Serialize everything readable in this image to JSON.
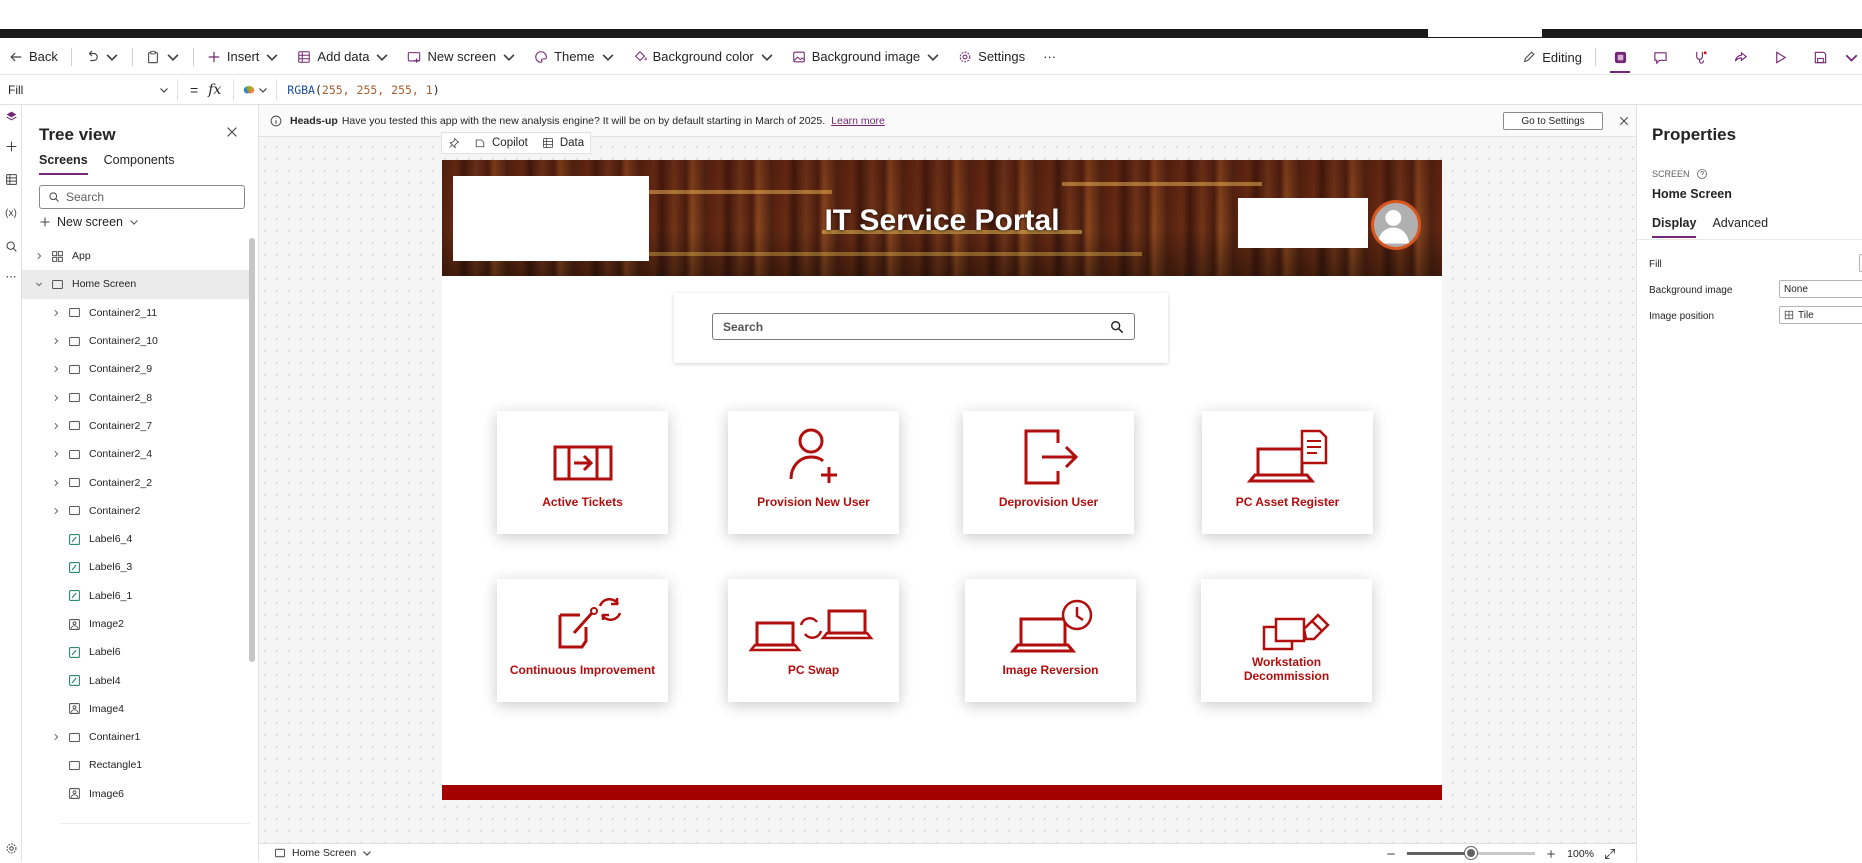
{
  "commandbar": {
    "back_label": "Back",
    "insert_label": "Insert",
    "add_data_label": "Add data",
    "new_screen_label": "New screen",
    "theme_label": "Theme",
    "bg_color_label": "Background color",
    "bg_image_label": "Background image",
    "settings_label": "Settings",
    "more_label": "···",
    "editing_label": "Editing"
  },
  "formulabar": {
    "property": "Fill",
    "fx": "fx",
    "equals": "=",
    "formula_fn": "RGBA",
    "formula_open": "(",
    "formula_args": "255, 255, 255, 1",
    "formula_close": ")"
  },
  "treeview": {
    "title": "Tree view",
    "tabs": [
      "Screens",
      "Components"
    ],
    "search_placeholder": "Search",
    "new_screen_label": "New screen",
    "nodes": [
      {
        "label": "App",
        "type": "app",
        "expandable": true,
        "indent": 0
      },
      {
        "label": "Home Screen",
        "type": "screen",
        "expandable": true,
        "expanded": true,
        "indent": 0,
        "selected": true
      },
      {
        "label": "Container2_11",
        "type": "container",
        "expandable": true,
        "indent": 1
      },
      {
        "label": "Container2_10",
        "type": "container",
        "expandable": true,
        "indent": 1
      },
      {
        "label": "Container2_9",
        "type": "container",
        "expandable": true,
        "indent": 1
      },
      {
        "label": "Container2_8",
        "type": "container",
        "expandable": true,
        "indent": 1
      },
      {
        "label": "Container2_7",
        "type": "container",
        "expandable": true,
        "indent": 1
      },
      {
        "label": "Container2_4",
        "type": "container",
        "expandable": true,
        "indent": 1
      },
      {
        "label": "Container2_2",
        "type": "container",
        "expandable": true,
        "indent": 1
      },
      {
        "label": "Container2",
        "type": "container",
        "expandable": true,
        "indent": 1
      },
      {
        "label": "Label6_4",
        "type": "label",
        "expandable": false,
        "indent": 1
      },
      {
        "label": "Label6_3",
        "type": "label",
        "expandable": false,
        "indent": 1
      },
      {
        "label": "Label6_1",
        "type": "label",
        "expandable": false,
        "indent": 1
      },
      {
        "label": "Image2",
        "type": "image",
        "expandable": false,
        "indent": 1
      },
      {
        "label": "Label6",
        "type": "label",
        "expandable": false,
        "indent": 1
      },
      {
        "label": "Label4",
        "type": "label",
        "expandable": false,
        "indent": 1
      },
      {
        "label": "Image4",
        "type": "image",
        "expandable": false,
        "indent": 1
      },
      {
        "label": "Container1",
        "type": "container",
        "expandable": true,
        "indent": 1
      },
      {
        "label": "Rectangle1",
        "type": "container",
        "expandable": false,
        "indent": 1
      },
      {
        "label": "Image6",
        "type": "image",
        "expandable": false,
        "indent": 1
      }
    ]
  },
  "headsup": {
    "title": "Heads-up",
    "message": "Have you tested this app with the new analysis engine? It will be on by default starting in March of 2025.",
    "link": "Learn more",
    "button": "Go to Settings"
  },
  "canvas_toolbar": {
    "copilot": "Copilot",
    "data": "Data"
  },
  "app": {
    "title": "IT Service Portal",
    "search_placeholder": "Search",
    "tiles": [
      {
        "label": "Active Tickets",
        "icon": "ticket-arrow-icon"
      },
      {
        "label": "Provision New User",
        "icon": "person-add-icon"
      },
      {
        "label": "Deprovision User",
        "icon": "sign-out-icon"
      },
      {
        "label": "PC Asset Register",
        "icon": "laptop-document-icon"
      },
      {
        "label": "Continuous Improvement",
        "icon": "edit-refresh-icon"
      },
      {
        "label": "PC Swap",
        "icon": "laptop-swap-icon"
      },
      {
        "label": "Image Reversion",
        "icon": "laptop-history-icon"
      },
      {
        "label": "Workstation Decommission",
        "icon": "workstation-eraser-icon"
      }
    ],
    "accent_color": "#b10e0e",
    "footer_color": "#a30000"
  },
  "statusbar": {
    "screen": "Home Screen",
    "zoom": "100%",
    "zoom_level": 0.5
  },
  "properties": {
    "title": "Properties",
    "kind": "SCREEN",
    "name": "Home Screen",
    "tabs": [
      "Display",
      "Advanced"
    ],
    "rows": [
      {
        "label": "Fill",
        "value": ""
      },
      {
        "label": "Background image",
        "value": "None"
      },
      {
        "label": "Image position",
        "value": "Tile"
      }
    ]
  }
}
